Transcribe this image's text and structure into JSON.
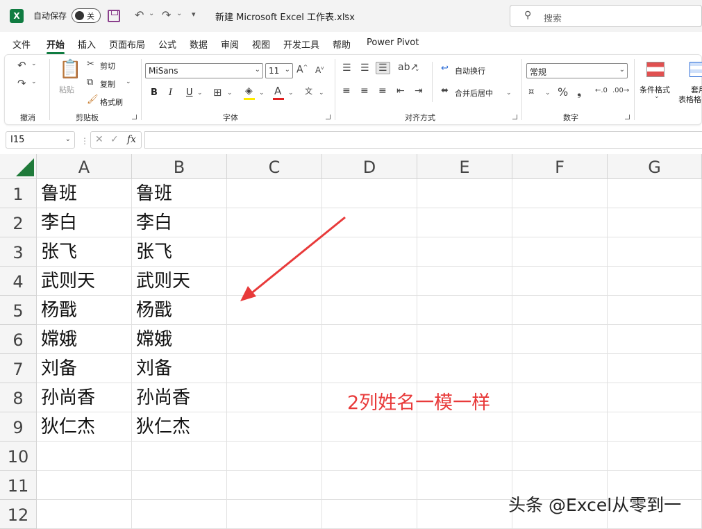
{
  "titlebar": {
    "autosave_label": "自动保存",
    "autosave_state": "关",
    "document_title": "新建 Microsoft Excel 工作表.xlsx",
    "search_placeholder": "搜索"
  },
  "tabs": [
    "文件",
    "开始",
    "插入",
    "页面布局",
    "公式",
    "数据",
    "审阅",
    "视图",
    "开发工具",
    "帮助",
    "Power Pivot"
  ],
  "active_tab": "开始",
  "ribbon": {
    "undo_group": "撤消",
    "clipboard": {
      "paste": "粘贴",
      "cut": "剪切",
      "copy": "复制",
      "format_painter": "格式刷",
      "label": "剪贴板"
    },
    "font": {
      "name": "MiSans",
      "size": "11",
      "label": "字体",
      "bold": "B",
      "italic": "I",
      "underline": "U"
    },
    "alignment": {
      "wrap_text": "自动换行",
      "merge_center": "合并后居中",
      "label": "对齐方式"
    },
    "number": {
      "format": "常规",
      "label": "数字"
    },
    "styles": {
      "conditional_format": "条件格式",
      "table_format_1": "套用",
      "table_format_2": "表格格"
    }
  },
  "formula_bar": {
    "name_box": "I15",
    "fx": "fx",
    "formula": ""
  },
  "sheet": {
    "columns": [
      "A",
      "B",
      "C",
      "D",
      "E",
      "F",
      "G"
    ],
    "rows": [
      "1",
      "2",
      "3",
      "4",
      "5",
      "6",
      "7",
      "8",
      "9",
      "10",
      "11",
      "12"
    ],
    "col_a": [
      "鲁班",
      "李白",
      "张飞",
      "武则天",
      "杨戬",
      "嫦娥",
      "刘备",
      "孙尚香",
      "狄仁杰"
    ],
    "col_b": [
      "鲁班",
      "李白",
      "张飞",
      "武则天",
      "杨戬",
      "嫦娥",
      "刘备",
      "孙尚香",
      "狄仁杰"
    ]
  },
  "annotation": "2列姓名一模一样",
  "watermark": "头条 @Excel从零到一",
  "colors": {
    "excel_green": "#107c41",
    "annotation_red": "#e83a3a"
  }
}
